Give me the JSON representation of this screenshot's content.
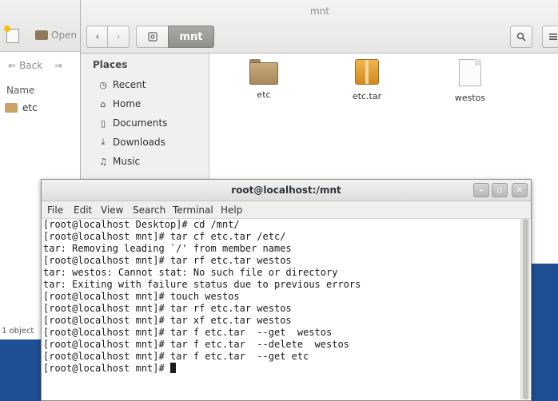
{
  "back_window": {
    "toolbar": {
      "new_label": "",
      "open_label": "Open",
      "back_label": "Back"
    },
    "list_header": "Name",
    "items": [
      {
        "name": "etc",
        "icon": "folder-icon"
      }
    ],
    "status": "1 object"
  },
  "file_manager": {
    "title": "mnt",
    "path": {
      "current": "mnt"
    },
    "sidebar": {
      "section": "Places",
      "items": [
        {
          "label": "Recent",
          "icon": "clock-icon"
        },
        {
          "label": "Home",
          "icon": "home-icon"
        },
        {
          "label": "Documents",
          "icon": "document-icon"
        },
        {
          "label": "Downloads",
          "icon": "download-icon"
        },
        {
          "label": "Music",
          "icon": "music-icon"
        }
      ]
    },
    "files": [
      {
        "name": "etc",
        "icon": "folder-icon"
      },
      {
        "name": "etc.tar",
        "icon": "package-icon"
      },
      {
        "name": "westos",
        "icon": "text-file-icon"
      }
    ]
  },
  "terminal": {
    "title": "root@localhost:/mnt",
    "menu": [
      "File",
      "Edit",
      "View",
      "Search",
      "Terminal",
      "Help"
    ],
    "lines": [
      "[root@localhost Desktop]# cd /mnt/",
      "[root@localhost mnt]# tar cf etc.tar /etc/",
      "tar: Removing leading `/' from member names",
      "[root@localhost mnt]# tar rf etc.tar westos",
      "tar: westos: Cannot stat: No such file or directory",
      "tar: Exiting with failure status due to previous errors",
      "[root@localhost mnt]# touch westos",
      "[root@localhost mnt]# tar rf etc.tar westos",
      "[root@localhost mnt]# tar xf etc.tar westos",
      "[root@localhost mnt]# tar f etc.tar  --get  westos",
      "[root@localhost mnt]# tar f etc.tar  --delete  westos",
      "[root@localhost mnt]# tar f etc.tar  --get etc"
    ],
    "prompt": "[root@localhost mnt]# "
  }
}
